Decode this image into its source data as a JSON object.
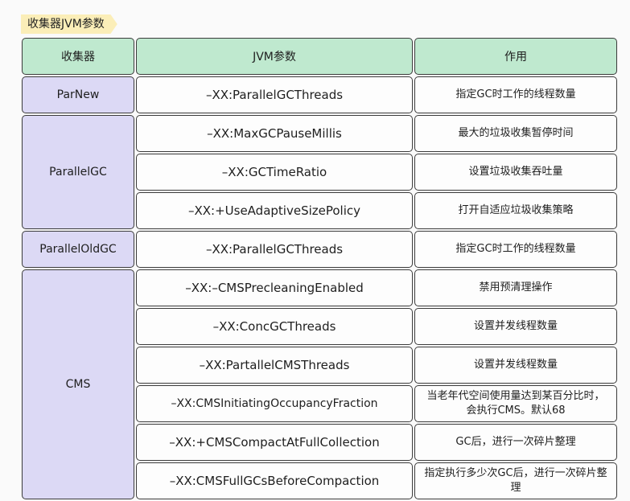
{
  "title": "收集器JVM参数",
  "header": {
    "collector": "收集器",
    "param": "JVM参数",
    "effect": "作用"
  },
  "rows": [
    {
      "param": "–XX:ParallelGCThreads",
      "effect": "指定GC时工作的线程数量"
    },
    {
      "param": "–XX:MaxGCPauseMillis",
      "effect": "最大的垃圾收集暂停时间"
    },
    {
      "param": "–XX:GCTimeRatio",
      "effect": "设置垃圾收集吞吐量"
    },
    {
      "param": "–XX:+UseAdaptiveSizePolicy",
      "effect": "打开自适应垃圾收集策略"
    },
    {
      "param": "–XX:ParallelGCThreads",
      "effect": "指定GC时工作的线程数量"
    },
    {
      "param": "–XX:–CMSPrecleaningEnabled",
      "effect": "禁用预清理操作"
    },
    {
      "param": "–XX:ConcGCThreads",
      "effect": "设置并发线程数量"
    },
    {
      "param": "–XX:PartallelCMSThreads",
      "effect": "设置并发线程数量"
    },
    {
      "param": "–XX:CMSInitiatingOccupancyFraction",
      "effect": "当老年代空间使用量达到某百分比时，会执行CMS。默认68"
    },
    {
      "param": "–XX:+CMSCompactAtFullCollection",
      "effect": "GC后，进行一次碎片整理"
    },
    {
      "param": "–XX:CMSFullGCsBeforeCompaction",
      "effect": "指定执行多少次GC后，进行一次碎片整理"
    }
  ],
  "collectors": {
    "parnew": "ParNew",
    "parallelgc": "ParallelGC",
    "paralleloldgc": "ParallelOldGC",
    "cms": "CMS"
  }
}
